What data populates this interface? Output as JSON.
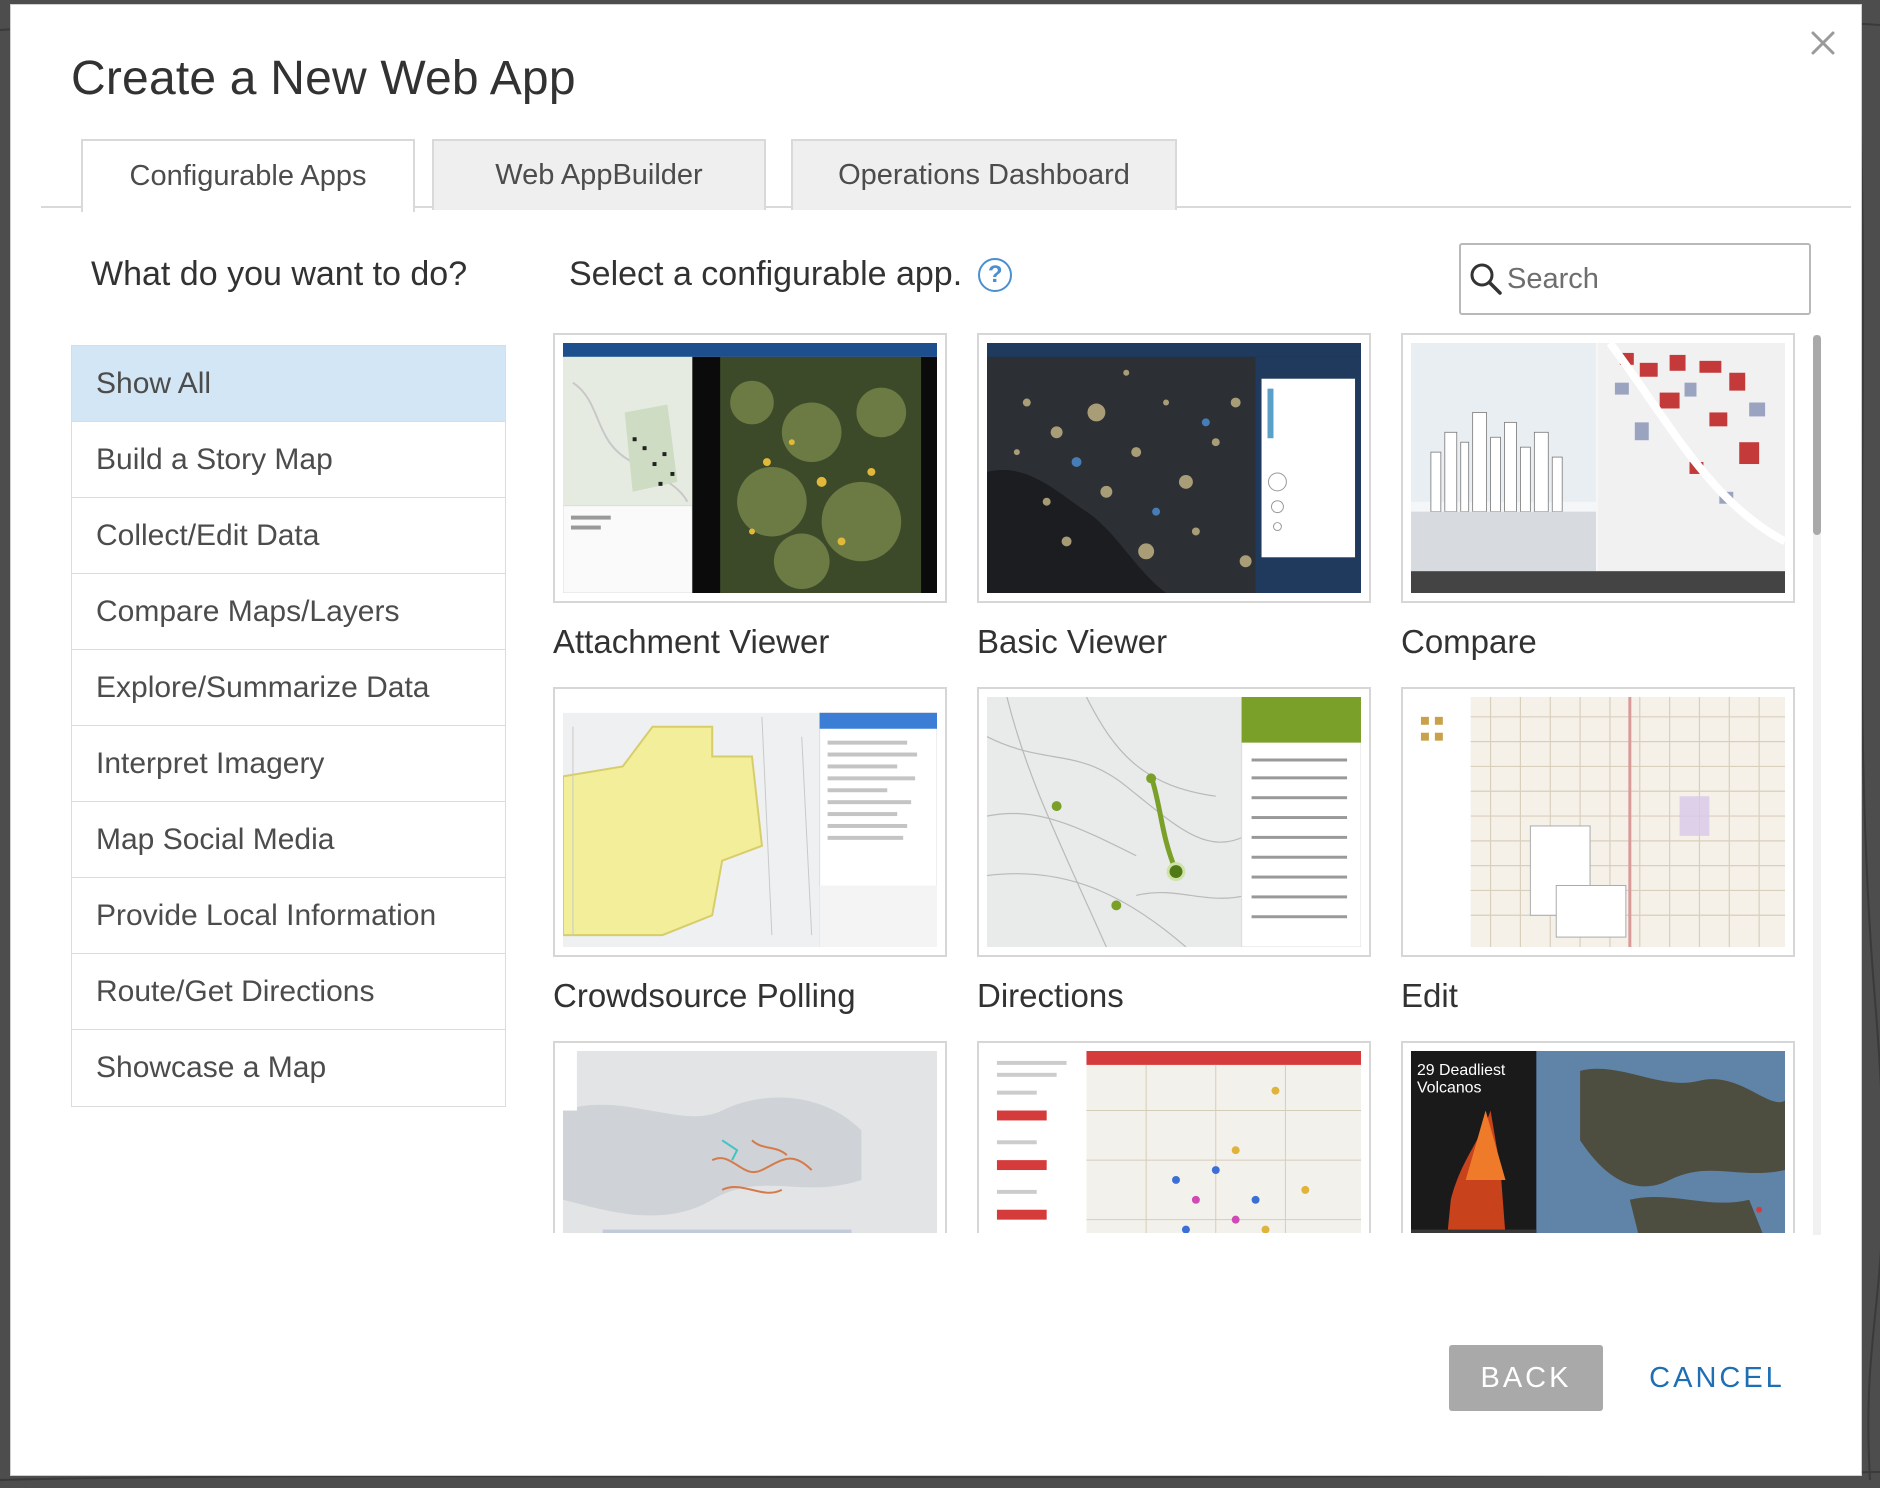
{
  "dialog": {
    "title": "Create a New Web App",
    "close_icon": "close-icon"
  },
  "tabs": [
    {
      "label": "Configurable Apps",
      "active": true
    },
    {
      "label": "Web AppBuilder",
      "active": false
    },
    {
      "label": "Operations Dashboard",
      "active": false
    }
  ],
  "left": {
    "heading": "What do you want to do?",
    "categories": [
      {
        "label": "Show All",
        "selected": true
      },
      {
        "label": "Build a Story Map",
        "selected": false
      },
      {
        "label": "Collect/Edit Data",
        "selected": false
      },
      {
        "label": "Compare Maps/Layers",
        "selected": false
      },
      {
        "label": "Explore/Summarize Data",
        "selected": false
      },
      {
        "label": "Interpret Imagery",
        "selected": false
      },
      {
        "label": "Map Social Media",
        "selected": false
      },
      {
        "label": "Provide Local Information",
        "selected": false
      },
      {
        "label": "Route/Get Directions",
        "selected": false
      },
      {
        "label": "Showcase a Map",
        "selected": false
      }
    ]
  },
  "right": {
    "heading": "Select a configurable app.",
    "help_icon": "help-icon",
    "search": {
      "placeholder": "Search",
      "value": ""
    },
    "apps": [
      {
        "label": "Attachment Viewer",
        "thumb_overlay": ""
      },
      {
        "label": "Basic Viewer",
        "thumb_overlay": ""
      },
      {
        "label": "Compare",
        "thumb_overlay": ""
      },
      {
        "label": "Crowdsource Polling",
        "thumb_overlay": ""
      },
      {
        "label": "Directions",
        "thumb_overlay": ""
      },
      {
        "label": "Edit",
        "thumb_overlay": ""
      },
      {
        "label": "",
        "thumb_overlay": ""
      },
      {
        "label": "",
        "thumb_overlay": ""
      },
      {
        "label": "",
        "thumb_overlay": "29 Deadliest Volcanos"
      }
    ]
  },
  "buttons": {
    "back": "BACK",
    "cancel": "CANCEL"
  },
  "colors": {
    "accent": "#1f6fb5",
    "selected_bg": "#d2e6f5",
    "back_bg": "#a9a9a9"
  }
}
